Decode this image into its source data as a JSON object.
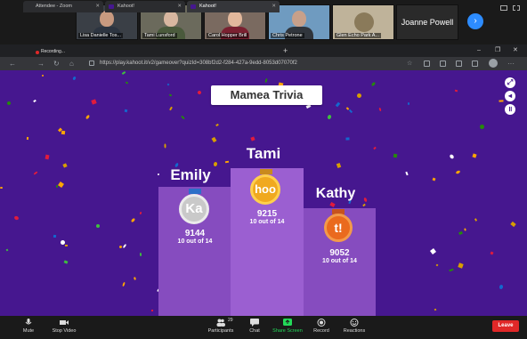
{
  "participants": [
    {
      "name": "Lisa Danielle Tos...",
      "active": false
    },
    {
      "name": "Tami Lunsford",
      "active": false
    },
    {
      "name": "Carol Hopper Brill",
      "active": false
    },
    {
      "name": "Chris Petrone",
      "active": false
    },
    {
      "name": "Glen Echo Park A...",
      "active": false
    },
    {
      "name": "Joanne Powell",
      "active": false
    }
  ],
  "recording": {
    "label": "Recording..."
  },
  "browser": {
    "tabs": [
      {
        "label": "Attendee - Zoom"
      },
      {
        "label": "Kahoot!"
      },
      {
        "label": "Kahoot!"
      }
    ],
    "new_tab": "+",
    "url": "https://play.kahoot.it/v2/gameover?quizId=308bf2d2-f284-427a-9edd-8053d07070f2"
  },
  "game": {
    "title": "Mamea Trivia",
    "podium": [
      {
        "rank": 1,
        "name": "Tami",
        "avatar": "hoo",
        "score": "9215",
        "detail": "10 out of 14"
      },
      {
        "rank": 2,
        "name": "Emily",
        "avatar": "Ka",
        "score": "9144",
        "detail": "10 out of 14"
      },
      {
        "rank": 3,
        "name": "Kathy",
        "avatar": "t!",
        "score": "9052",
        "detail": "10 out of 14"
      }
    ]
  },
  "toolbar": {
    "mute": "Mute",
    "stop_video": "Stop Video",
    "participants": "Participants",
    "participant_count": "29",
    "chat": "Chat",
    "share_screen": "Share Screen",
    "record": "Record",
    "reactions": "Reactions",
    "leave": "Leave"
  },
  "colors": {
    "kahoot_purple": "#46178f",
    "podium": "#864cbf",
    "share_green": "#23d959",
    "leave_red": "#e02828"
  }
}
